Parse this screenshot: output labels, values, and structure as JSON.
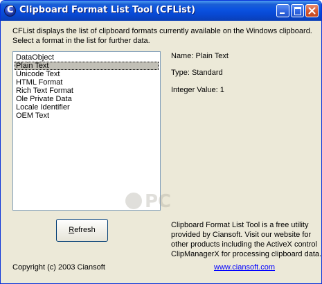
{
  "window": {
    "title": "Clipboard Format List Tool (CFList)",
    "icon": "cflist-app-icon"
  },
  "titlebar_buttons": {
    "minimize": "minimize-icon",
    "maximize": "maximize-icon",
    "close": "close-icon"
  },
  "description": {
    "line1": "CFList displays the list of clipboard formats currently available on the Windows clipboard.",
    "line2": "Select a format in the list for further data."
  },
  "formats_list": {
    "items": [
      "DataObject",
      "Plain Text",
      "Unicode Text",
      "HTML Format",
      "Rich Text Format",
      "Ole Private Data",
      "Locale Identifier",
      "OEM Text"
    ],
    "selected": "Plain Text"
  },
  "details": {
    "name": "Name: Plain Text",
    "type": "Type: Standard",
    "integer_value": "Integer Value: 1"
  },
  "refresh_button": {
    "accel": "R",
    "rest": "efresh"
  },
  "info": {
    "line1": "Clipboard Format List Tool is a free utility",
    "line2": "provided by Ciansoft.  Visit our website for",
    "line3": "other products including the ActiveX control",
    "line4": "ClipManagerX for processing clipboard data."
  },
  "copyright": "Copyright (c) 2003 Ciansoft",
  "website_link": "www.ciansoft.com",
  "colors": {
    "titlebar": "#0a52e0",
    "window_bg": "#ece9d8",
    "selection": "#c1bfb6",
    "link": "#0000ff"
  }
}
